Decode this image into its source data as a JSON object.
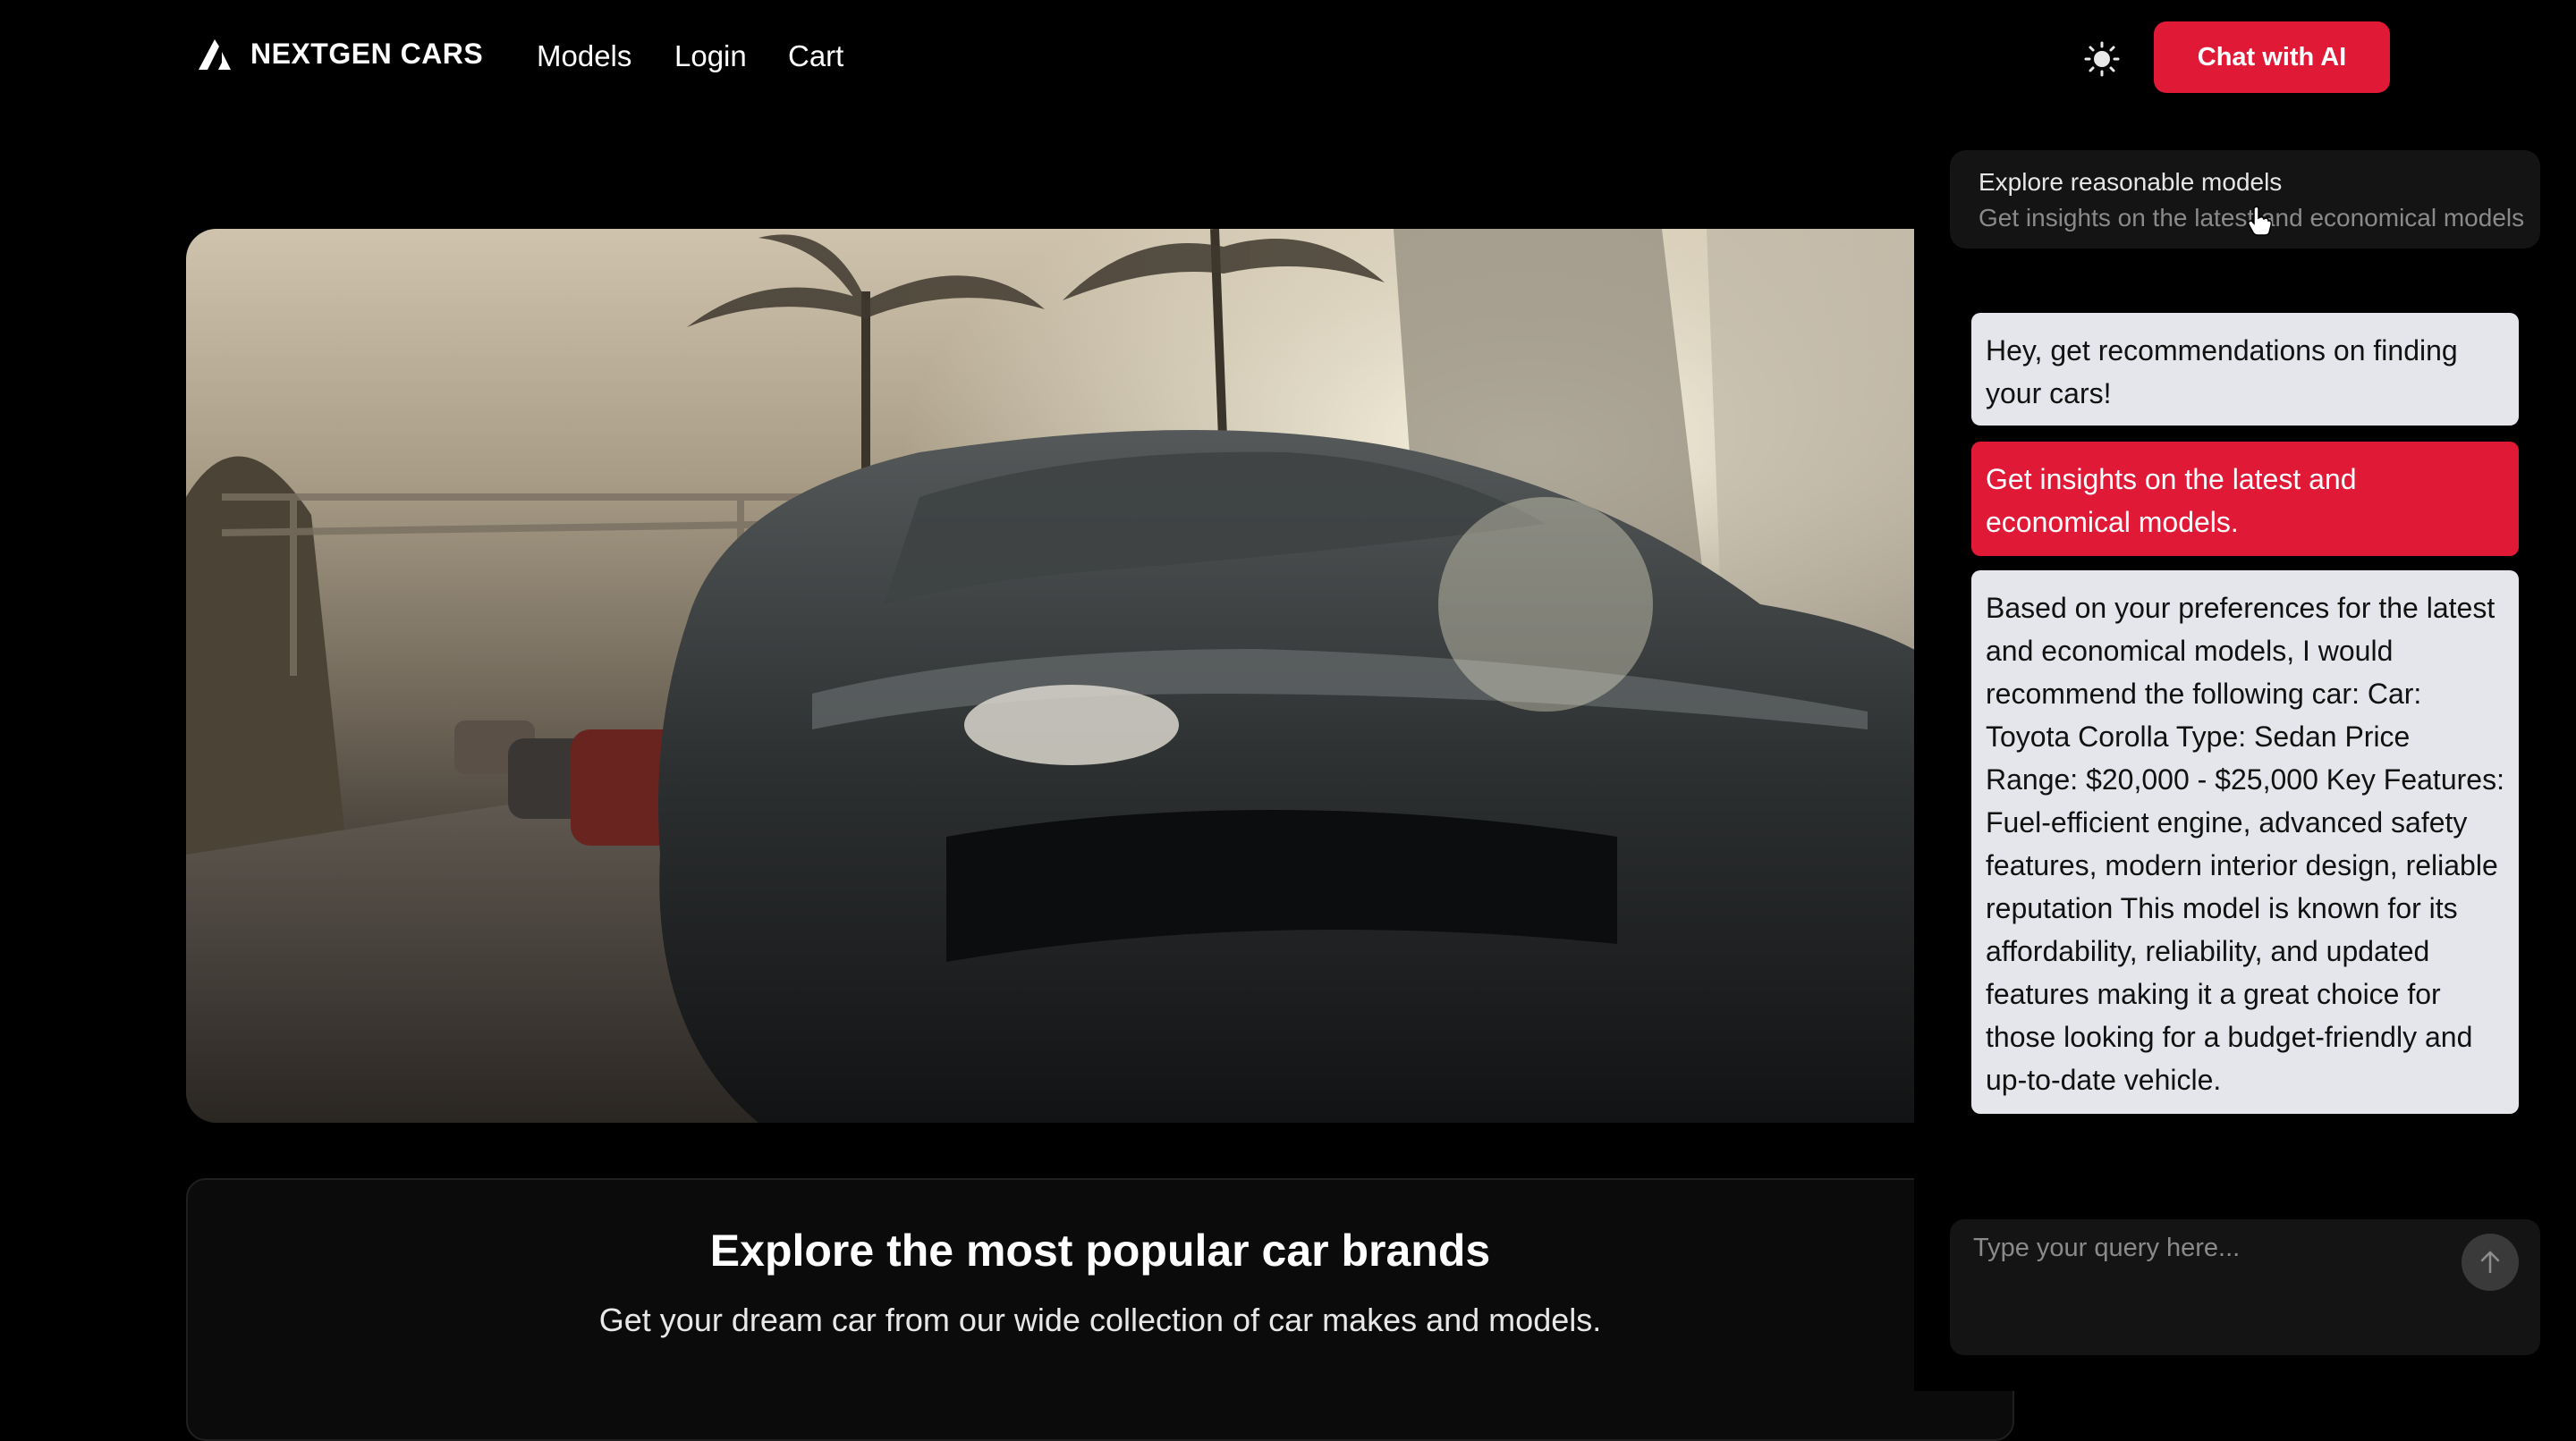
{
  "nav": {
    "brand": "NEXTGEN CARS",
    "links": [
      "Models",
      "Login",
      "Cart"
    ],
    "theme_icon": "sun-icon",
    "chat_button": "Chat with AI"
  },
  "hero": {
    "image": "sports-car-street-photo"
  },
  "brands": {
    "title": "Explore the most popular car brands",
    "subtitle": "Get your dream car from our wide collection of car makes and models."
  },
  "chat": {
    "suggestion": {
      "title": "Explore reasonable models",
      "subtitle": "Get insights on the latest and economical models"
    },
    "messages": [
      {
        "role": "ai",
        "text": "Hey, get recommendations on finding your cars!"
      },
      {
        "role": "user",
        "text": "Get insights on the latest and economical models."
      },
      {
        "role": "ai",
        "text": "Based on your preferences for the latest and economical models, I would recommend the following car: Car: Toyota Corolla Type: Sedan Price Range: $20,000 - $25,000 Key Features: Fuel-efficient engine, advanced safety features, modern interior design, reliable reputation This model is known for its affordability, reliability, and updated features making it a great choice for those looking for a budget-friendly and up-to-date vehicle."
      }
    ],
    "input_placeholder": "Type your query here...",
    "send_icon": "arrow-up-icon"
  },
  "colors": {
    "accent": "#e01936",
    "ai_bubble": "#e5e6eb",
    "panel": "#141414"
  }
}
